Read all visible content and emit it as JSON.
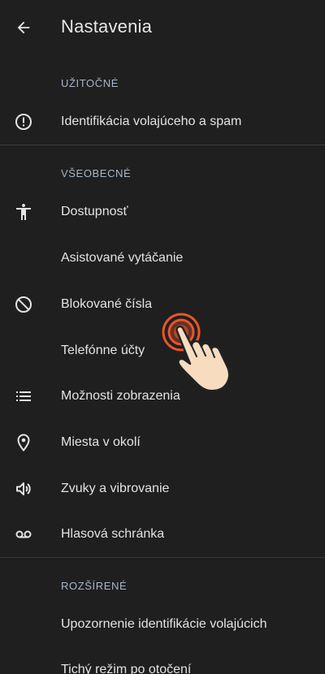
{
  "header": {
    "title": "Nastavenia",
    "back_icon": "arrow-back-icon"
  },
  "sections": {
    "useful": {
      "title": "UŽITOČNÉ"
    },
    "general": {
      "title": "VŠEOBECNÉ"
    },
    "advanced": {
      "title": "ROZŠÍRENÉ"
    }
  },
  "items": {
    "caller_id": {
      "label": "Identifikácia volajúceho a spam",
      "icon": "alert-circle-icon"
    },
    "accessibility": {
      "label": "Dostupnosť",
      "icon": "accessibility-icon"
    },
    "assisted_dialing": {
      "label": "Asistované vytáčanie"
    },
    "blocked_numbers": {
      "label": "Blokované čísla",
      "icon": "block-icon"
    },
    "phone_accounts": {
      "label": "Telefónne účty"
    },
    "display_options": {
      "label": "Možnosti zobrazenia",
      "icon": "list-icon"
    },
    "nearby_places": {
      "label": "Miesta v okolí",
      "icon": "location-pin-icon"
    },
    "sounds_vibration": {
      "label": "Zvuky a vibrovanie",
      "icon": "volume-icon"
    },
    "voicemail": {
      "label": "Hlasová schránka",
      "icon": "voicemail-icon"
    },
    "caller_id_announcement": {
      "label": "Upozornenie identifikácie volajúcich"
    },
    "flip_to_silence": {
      "label": "Tichý režim po otočení"
    }
  },
  "colors": {
    "background": "#1f1f1f",
    "text": "#e3e3e3",
    "section_header": "#a8b5c8",
    "divider": "#3a3a3a",
    "tap_ring": "#e8552b"
  },
  "overlay": {
    "icon": "tap-hand-icon"
  }
}
